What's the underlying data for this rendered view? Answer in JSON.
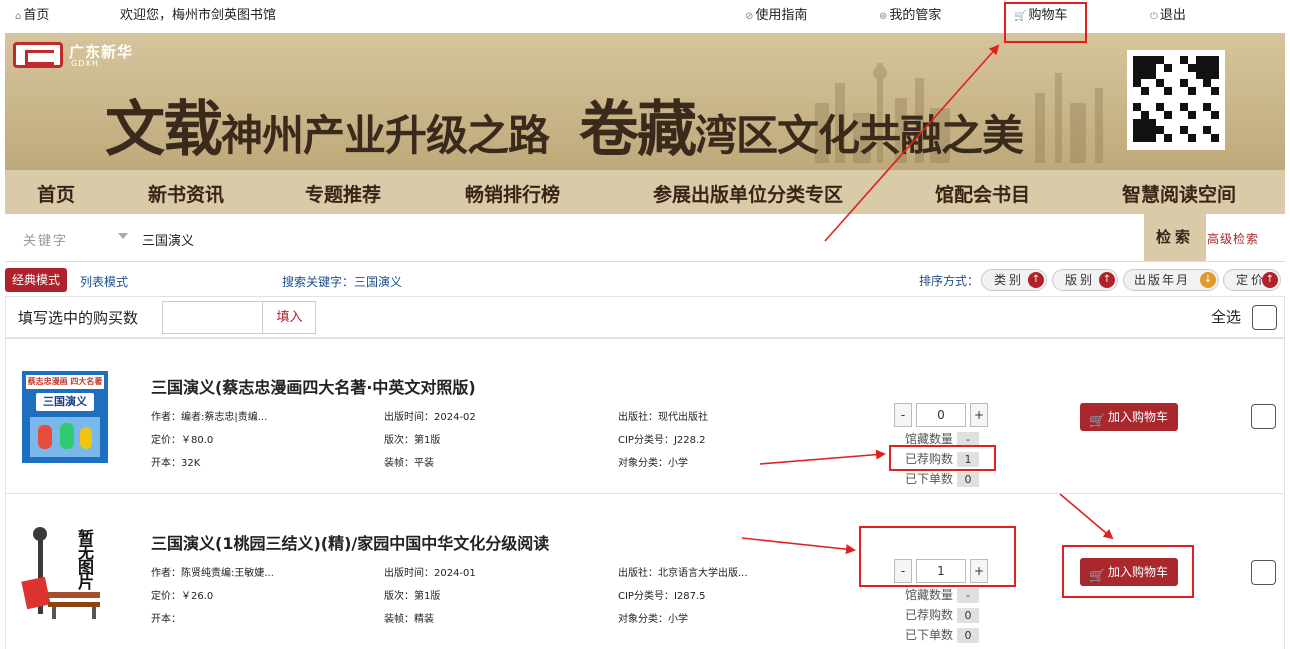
{
  "topbar": {
    "home": "首页",
    "welcome": "欢迎您，梅州市剑英图书馆",
    "guide": "使用指南",
    "manager": "我的管家",
    "cart": "购物车",
    "logout": "退出"
  },
  "banner": {
    "logo_cn": "广东新华",
    "logo_en": "GDXH",
    "slogan_1_big": "文载",
    "slogan_1_rest": "神州产业升级之路",
    "slogan_2_big": "卷藏",
    "slogan_2_rest": "湾区文化共融之美"
  },
  "nav": [
    "首页",
    "新书资讯",
    "专题推荐",
    "畅销排行榜",
    "参展出版单位分类专区",
    "馆配会书目",
    "智慧阅读空间"
  ],
  "search": {
    "field": "关键字",
    "keyword": "三国演义",
    "button": "检索",
    "advanced": "高级检索"
  },
  "modes": {
    "classic": "经典模式",
    "list": "列表模式",
    "keyword_label": "搜索关键字：三国演义",
    "sort_label": "排序方式：",
    "sorts": [
      "类别",
      "版别",
      "出版年月",
      "定价"
    ]
  },
  "fill": {
    "label": "填写选中的购买数",
    "button": "填入",
    "select_all": "全选"
  },
  "products": [
    {
      "title": "三国演义(蔡志忠漫画四大名著·中英文对照版)",
      "author": "作者：编者:蔡志忠|责编...",
      "date": "出版时间：2024-02",
      "publisher": "出版社：现代出版社",
      "price": "定价：￥80.0",
      "edition": "版次：第1版",
      "cip": "CIP分类号：J228.2",
      "format": "开本：32K",
      "binding": "装帧：平装",
      "audience": "对象分类：小学",
      "qty": "0",
      "stats": [
        {
          "label": "馆藏数量",
          "value": "-"
        },
        {
          "label": "已荐购数",
          "value": "1"
        },
        {
          "label": "已下单数",
          "value": "0"
        }
      ],
      "cart_button": "加入购物车",
      "cover_title": "三国演义",
      "cover_top": "蔡志忠漫画 四大名著"
    },
    {
      "title": "三国演义(1桃园三结义)(精)/家园中国中华文化分级阅读",
      "author": "作者：陈贤纯责编:王敏婕...",
      "date": "出版时间：2024-01",
      "publisher": "出版社：北京语言大学出版...",
      "price": "定价：￥26.0",
      "edition": "版次：第1版",
      "cip": "CIP分类号：I287.5",
      "format": "开本：",
      "binding": "装帧：精装",
      "audience": "对象分类：小学",
      "qty": "1",
      "stats": [
        {
          "label": "馆藏数量",
          "value": "-"
        },
        {
          "label": "已荐购数",
          "value": "0"
        },
        {
          "label": "已下单数",
          "value": "0"
        }
      ],
      "cart_button": "加入购物车",
      "cover_text": "暂无图片"
    }
  ],
  "colors": {
    "brand_red": "#b0222b",
    "nav_bg": "#d9caa8",
    "annotation_red": "#e02020"
  }
}
